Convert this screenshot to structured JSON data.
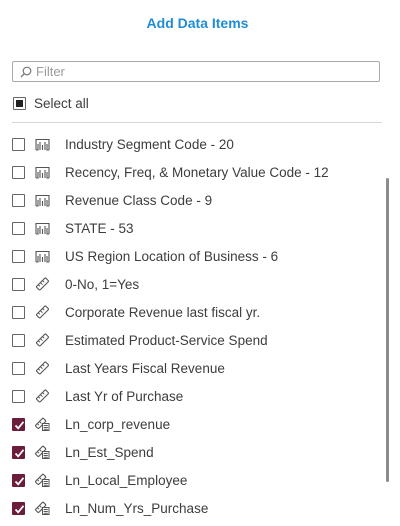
{
  "dialog": {
    "title": "Add Data Items"
  },
  "filter": {
    "placeholder": "Filter",
    "value": ""
  },
  "select_all": {
    "label": "Select all",
    "state": "partial"
  },
  "items": [
    {
      "label": "Industry Segment Code - 20",
      "icon": "category-icon",
      "checked": false
    },
    {
      "label": "Recency, Freq, & Monetary Value Code - 12",
      "icon": "category-icon",
      "checked": false
    },
    {
      "label": "Revenue Class Code - 9",
      "icon": "category-icon",
      "checked": false
    },
    {
      "label": "STATE - 53",
      "icon": "category-icon",
      "checked": false
    },
    {
      "label": "US Region Location of Business - 6",
      "icon": "category-icon",
      "checked": false
    },
    {
      "label": "0-No, 1=Yes",
      "icon": "measure-icon",
      "checked": false
    },
    {
      "label": "Corporate Revenue last fiscal yr.",
      "icon": "measure-icon",
      "checked": false
    },
    {
      "label": "Estimated Product-Service Spend",
      "icon": "measure-icon",
      "checked": false
    },
    {
      "label": "Last Years Fiscal Revenue",
      "icon": "measure-icon",
      "checked": false
    },
    {
      "label": "Last Yr of Purchase",
      "icon": "measure-icon",
      "checked": false
    },
    {
      "label": "Ln_corp_revenue",
      "icon": "calculated-measure-icon",
      "checked": true
    },
    {
      "label": "Ln_Est_Spend",
      "icon": "calculated-measure-icon",
      "checked": true
    },
    {
      "label": "Ln_Local_Employee",
      "icon": "calculated-measure-icon",
      "checked": true
    },
    {
      "label": "Ln_Num_Yrs_Purchase",
      "icon": "calculated-measure-icon",
      "checked": true
    }
  ],
  "colors": {
    "accent": "#1f8dd6",
    "checked": "#6b1d3b"
  }
}
